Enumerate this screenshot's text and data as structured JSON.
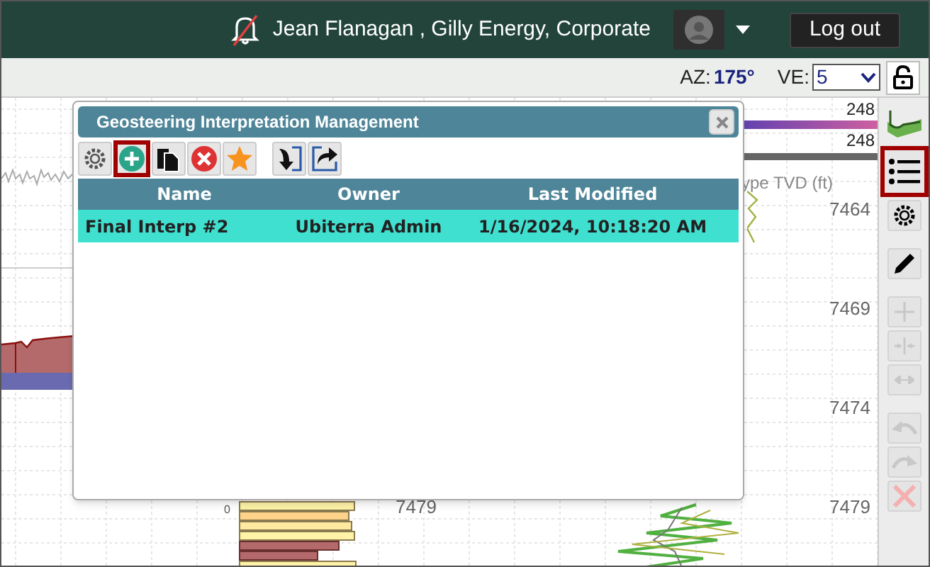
{
  "header": {
    "user": "Jean Flanagan , Gilly Energy, Corporate",
    "logout": "Log out"
  },
  "toolbar": {
    "az_label": "AZ:",
    "az_value": "175°",
    "ve_label": "VE:",
    "ve_value": "5"
  },
  "chart": {
    "axis_title": "ype TVD (ft)",
    "depth_labels": [
      "7464",
      "7469",
      "7474",
      "7479"
    ],
    "scale_values": [
      "248",
      "248"
    ],
    "track_depth": "7479",
    "track_zero": "0"
  },
  "dialog": {
    "title": "Geosteering Interpretation Management",
    "tools": [
      {
        "kind": "gear",
        "highlighted": false
      },
      {
        "kind": "add",
        "highlighted": true
      },
      {
        "kind": "copy",
        "highlighted": false
      },
      {
        "kind": "delete",
        "highlighted": false
      },
      {
        "kind": "star",
        "highlighted": false
      },
      {
        "kind": "import",
        "highlighted": false
      },
      {
        "kind": "export",
        "highlighted": false
      }
    ],
    "columns": [
      "Name",
      "Owner",
      "Last Modified"
    ],
    "rows": [
      {
        "cells": [
          "Final Interp #2",
          "Ubiterra Admin",
          "1/16/2024, 10:18:20 AM"
        ],
        "selected": true
      }
    ]
  },
  "side_tools": [
    {
      "kind": "layers",
      "disabled": false,
      "highlighted": false
    },
    {
      "kind": "list",
      "disabled": false,
      "highlighted": true
    },
    {
      "kind": "gear",
      "disabled": false,
      "highlighted": false
    },
    {
      "kind": "pencil",
      "disabled": false,
      "highlighted": false
    },
    {
      "kind": "plus",
      "disabled": true,
      "highlighted": false
    },
    {
      "kind": "split",
      "disabled": true,
      "highlighted": false
    },
    {
      "kind": "stretch",
      "disabled": true,
      "highlighted": false
    },
    {
      "kind": "undo",
      "disabled": true,
      "highlighted": false
    },
    {
      "kind": "redo",
      "disabled": true,
      "highlighted": false
    },
    {
      "kind": "cancel",
      "disabled": true,
      "highlighted": false
    }
  ]
}
